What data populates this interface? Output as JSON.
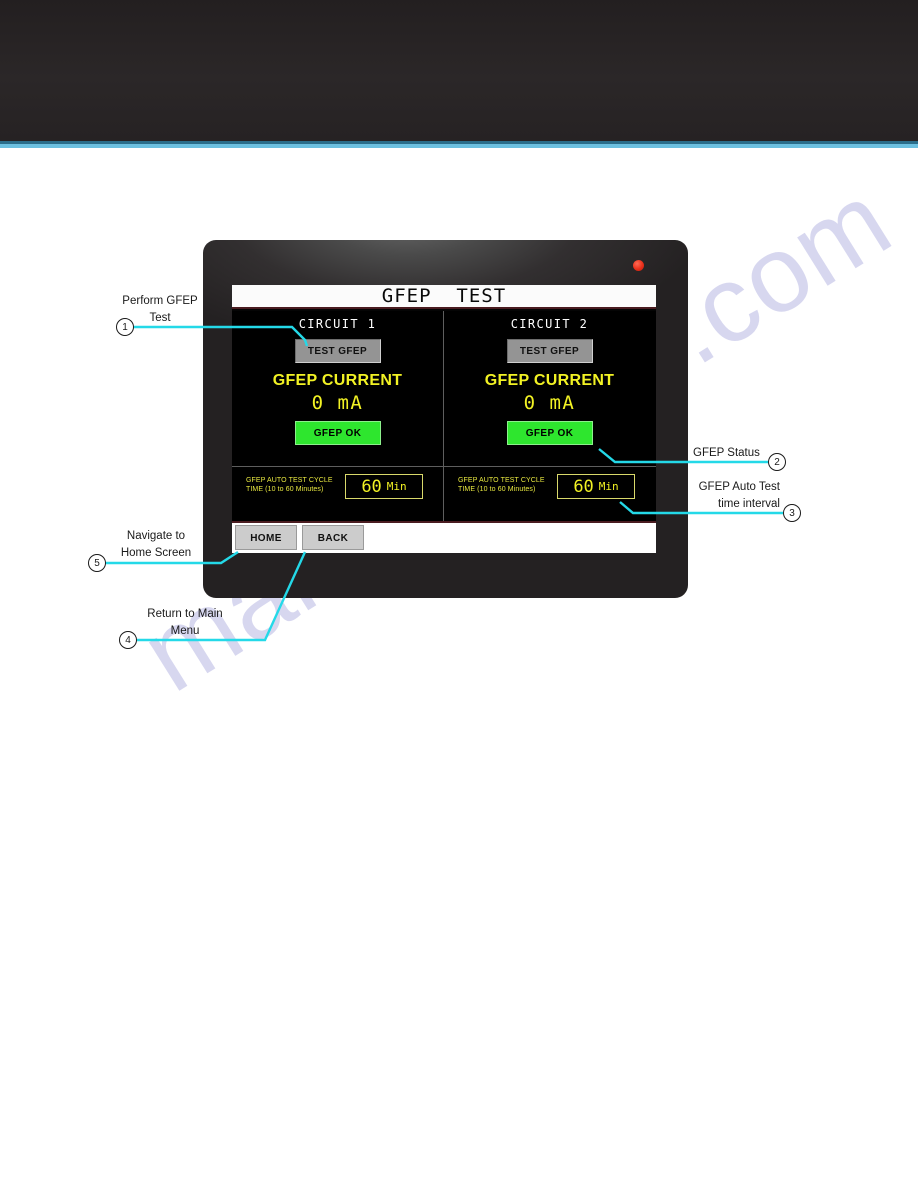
{
  "page": {
    "watermark": "manualshive.com",
    "header_band_color": "#262223",
    "accent_rule_color": "#6cc0e0"
  },
  "device": {
    "led": {
      "name": "power-led",
      "color": "#ea2f1a"
    },
    "screen": {
      "title": "GFEP  TEST",
      "circuits": [
        {
          "name": "CIRCUIT 1",
          "test_button": "TEST GFEP",
          "current_label": "GFEP CURRENT",
          "current_value": "0 mA",
          "status_button": "GFEP OK",
          "status_color": "#2ee62e",
          "auto_test_text": "GFEP AUTO TEST CYCLE TIME (10 to 60 Minutes)",
          "auto_test_value": "60",
          "auto_test_unit": "Min"
        },
        {
          "name": "CIRCUIT 2",
          "test_button": "TEST GFEP",
          "current_label": "GFEP CURRENT",
          "current_value": "0 mA",
          "status_button": "GFEP OK",
          "status_color": "#2ee62e",
          "auto_test_text": "GFEP AUTO TEST CYCLE TIME (10 to 60 Minutes)",
          "auto_test_value": "60",
          "auto_test_unit": "Min"
        }
      ],
      "footer": {
        "home_label": "HOME",
        "back_label": "BACK"
      }
    }
  },
  "callouts": [
    {
      "number": "1",
      "line1": "Perform GFEP",
      "line2": "Test"
    },
    {
      "number": "2",
      "line1": "GFEP Status",
      "line2": ""
    },
    {
      "number": "3",
      "line1": "GFEP Auto Test",
      "line2": "time interval"
    },
    {
      "number": "4",
      "line1": "Return to Main",
      "line2": "Menu"
    },
    {
      "number": "5",
      "line1": "Navigate to",
      "line2": "Home Screen"
    }
  ]
}
